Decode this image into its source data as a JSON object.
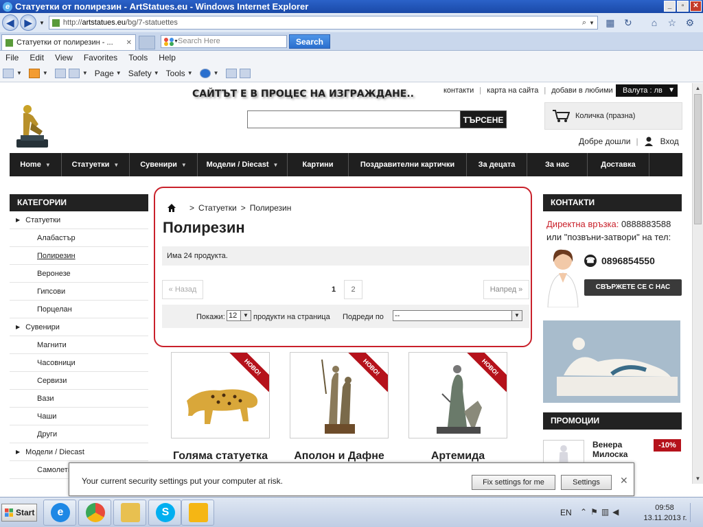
{
  "window": {
    "title": "Статуетки от полирезин - ArtStatues.eu - Windows Internet Explorer",
    "min": "_",
    "max": "▫",
    "close": "✕"
  },
  "address": {
    "prefix": "http://",
    "domain": "artstatues.eu",
    "path": "/bg/7-statuettes"
  },
  "tabs": [
    {
      "label": "Статуетки от полирезин - ...",
      "close": "✕"
    }
  ],
  "toolbar_search": {
    "placeholder": "Search Here",
    "button": "Search"
  },
  "menu": [
    "File",
    "Edit",
    "View",
    "Favorites",
    "Tools",
    "Help"
  ],
  "commands": {
    "page": "Page",
    "safety": "Safety",
    "tools": "Tools"
  },
  "site": {
    "notice": "САЙТЪТ Е В ПРОЦЕС НА ИЗГРАЖДАНЕ..",
    "toplinks": [
      "контакти",
      "карта на сайта",
      "добави в любими"
    ],
    "currency": "Валута : лв",
    "search_button": "ТЪРСЕНЕ",
    "cart": "Количка (празна)",
    "welcome": "Добре дошли",
    "login": "Вход",
    "nav": [
      {
        "label": "Home",
        "caret": "▼"
      },
      {
        "label": "Статуетки",
        "caret": "▼"
      },
      {
        "label": "Сувенири",
        "caret": "▼"
      },
      {
        "label": "Модели / Diecast",
        "caret": "▼"
      },
      {
        "label": "Картини",
        "caret": ""
      },
      {
        "label": "Поздравителни картички",
        "caret": ""
      },
      {
        "label": "За децата",
        "caret": ""
      },
      {
        "label": "За нас",
        "caret": ""
      },
      {
        "label": "Доставка",
        "caret": ""
      }
    ],
    "categories_title": "КАТЕГОРИИ",
    "categories": [
      {
        "label": "Статуетки",
        "level": "top"
      },
      {
        "label": "Алабастър",
        "level": "sub"
      },
      {
        "label": "Полирезин",
        "level": "sub",
        "active": true
      },
      {
        "label": "Веронезе",
        "level": "sub"
      },
      {
        "label": "Гипсови",
        "level": "sub"
      },
      {
        "label": "Порцелан",
        "level": "sub"
      },
      {
        "label": "Сувенири",
        "level": "top"
      },
      {
        "label": "Магнити",
        "level": "sub"
      },
      {
        "label": "Часовници",
        "level": "sub"
      },
      {
        "label": "Сервизи",
        "level": "sub"
      },
      {
        "label": "Вази",
        "level": "sub"
      },
      {
        "label": "Чаши",
        "level": "sub"
      },
      {
        "label": "Други",
        "level": "sub"
      },
      {
        "label": "Модели / Diecast",
        "level": "top"
      },
      {
        "label": "Самолети",
        "level": "sub"
      }
    ],
    "breadcrumb": {
      "sep": ">",
      "parent": "Статуетки",
      "current": "Полирезин"
    },
    "page_title": "Полирезин",
    "product_count": "Има 24 продукта.",
    "pager": {
      "prev": "« Назад",
      "current": "1",
      "next_num": "2",
      "next": "Напред »"
    },
    "filter": {
      "show_label": "Покажи:",
      "show_value": "12",
      "per_page": "продукти на страница",
      "sort_label": "Подреди по",
      "sort_value": "--"
    },
    "products": [
      {
        "name": "Голяма статуетка",
        "badge": "НОВО!"
      },
      {
        "name": "Аполон и Дафне",
        "badge": "НОВО!"
      },
      {
        "name": "Артемида",
        "badge": "НОВО!"
      }
    ],
    "contacts_title": "КОНТАКТИ",
    "direct_label": "Директна връзка:",
    "direct_phone": "0888883588",
    "callback_text": "или \"позвъни-затвори\" на тел:",
    "phone2": "0896854550",
    "contact_button": "СВЪРЖЕТЕ СЕ С НАС",
    "promo_title": "ПРОМОЦИИ",
    "promo_item": {
      "name": "Венера Милоска",
      "discount": "-10%"
    }
  },
  "security": {
    "message": "Your current security settings put your computer at risk.",
    "fix": "Fix settings for me",
    "settings": "Settings",
    "close": "✕"
  },
  "taskbar": {
    "start": "Start",
    "lang": "EN",
    "time": "09:58",
    "date": "13.11.2013 г."
  }
}
